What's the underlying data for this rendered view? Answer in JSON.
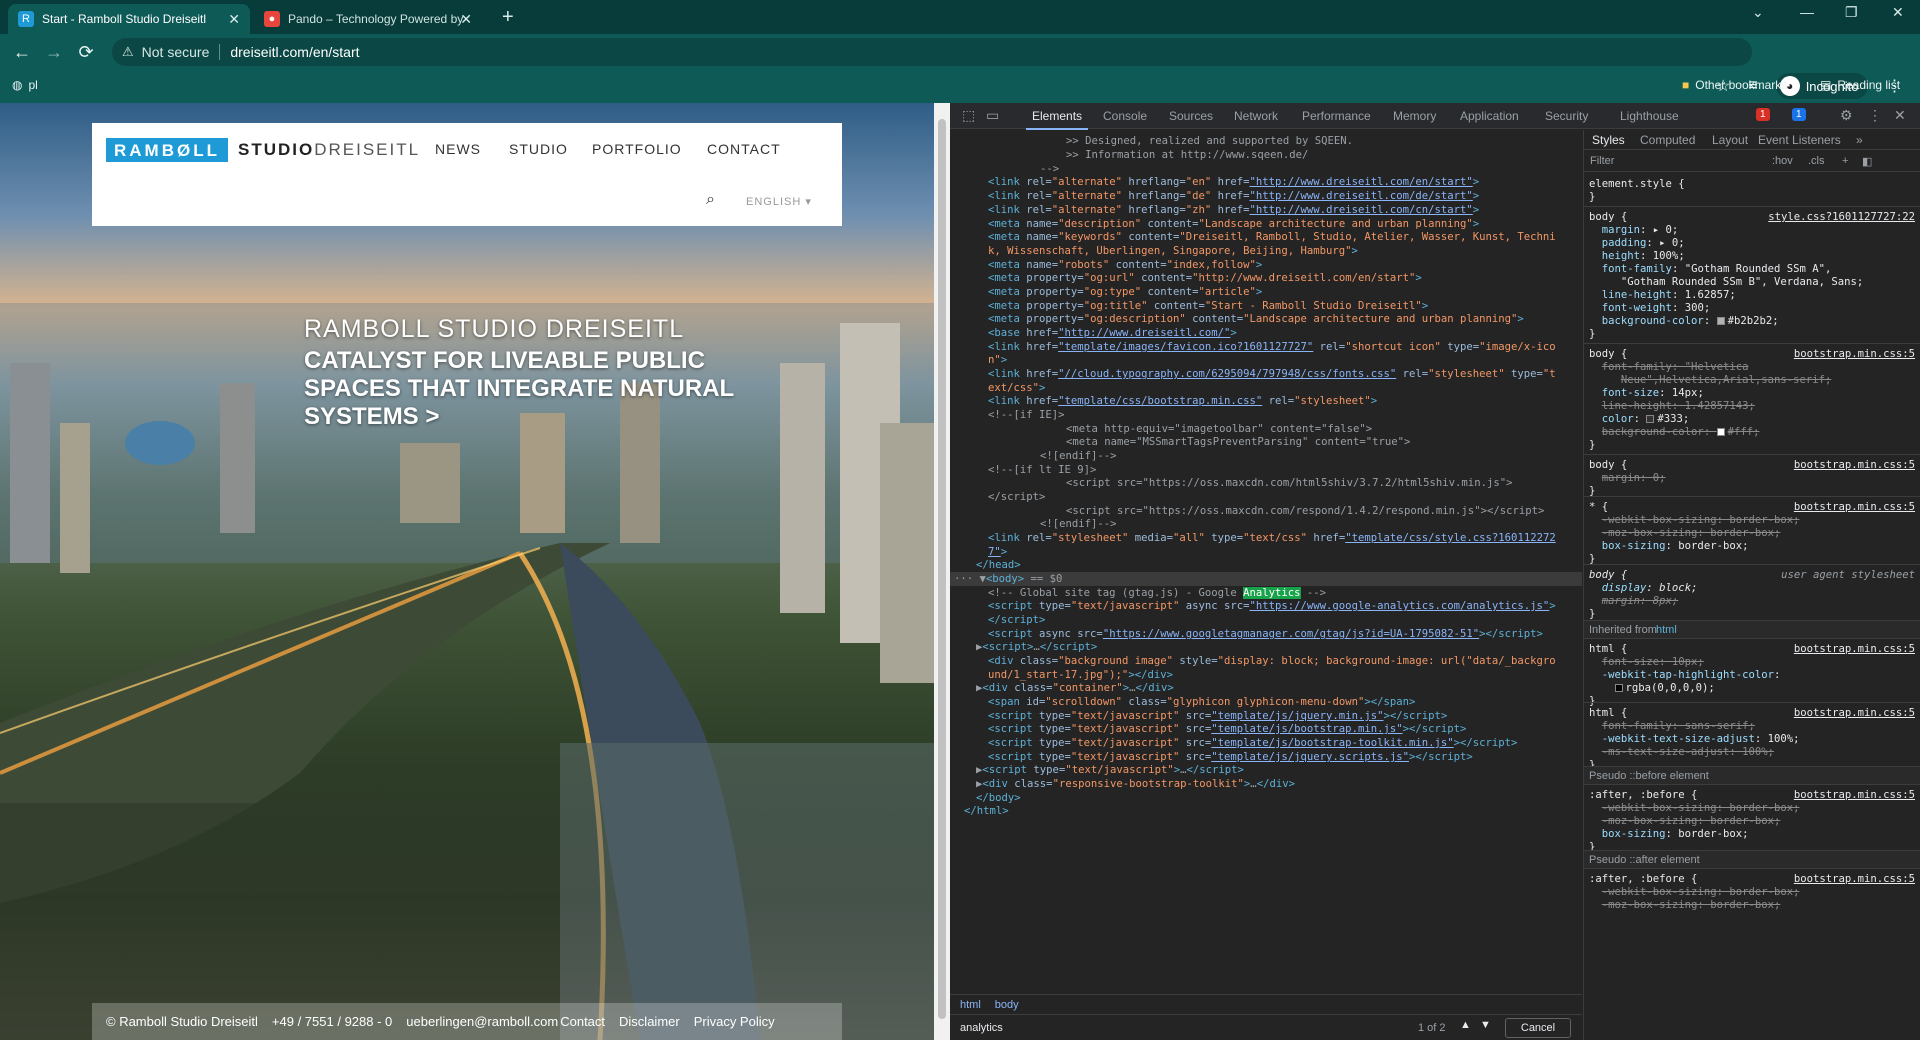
{
  "browser": {
    "tabs": [
      {
        "title": "Start - Ramboll Studio Dreiseitl",
        "active": true
      },
      {
        "title": "Pando – Technology Powered by",
        "active": false
      }
    ],
    "address": {
      "security": "Not secure",
      "url": "dreiseitl.com/en/start"
    },
    "profile": "Incognito",
    "bookmarks": {
      "left": "pl",
      "other": "Other bookmarks",
      "reading": "Reading list"
    }
  },
  "site": {
    "logo_left": "RAMBØLL",
    "logo_studio": "STUDIO",
    "logo_dreiseitl": "DREISEITL",
    "nav": [
      "NEWS",
      "STUDIO",
      "PORTFOLIO",
      "CONTACT"
    ],
    "language": "ENGLISH ▾",
    "hero_line1": "RAMBOLL STUDIO DREISEITL",
    "hero_line2": "CATALYST FOR LIVEABLE PUBLIC SPACES THAT INTEGRATE NATURAL SYSTEMS >",
    "footer": [
      "© Ramboll Studio Dreiseitl",
      "+49 / 7551 / 9288 - 0",
      "ueberlingen@ramboll.com",
      "Contact",
      "Disclaimer",
      "Privacy Policy"
    ]
  },
  "devtools": {
    "tabs": [
      "Elements",
      "Console",
      "Sources",
      "Network",
      "Performance",
      "Memory",
      "Application",
      "Security",
      "Lighthouse"
    ],
    "errors": "1",
    "messages": "1",
    "breadcrumb": [
      "html",
      "body"
    ],
    "find": {
      "query": "analytics",
      "count": "1 of 2",
      "cancel": "Cancel"
    },
    "styles_tabs": [
      "Styles",
      "Computed",
      "Layout",
      "Event Listeners"
    ],
    "filter_placeholder": "Filter",
    "filter_hov": ":hov",
    "filter_cls": ".cls",
    "inherited_label": "Inherited from",
    "inherited_tag": "html",
    "pseudo_before": "Pseudo ::before element",
    "pseudo_after": "Pseudo ::after element",
    "accent_colors": {
      "tab_active": "#8ab4f8",
      "highlight": "#17a34a",
      "error_badge": "#d93025",
      "msg_badge": "#1a73e8"
    }
  }
}
